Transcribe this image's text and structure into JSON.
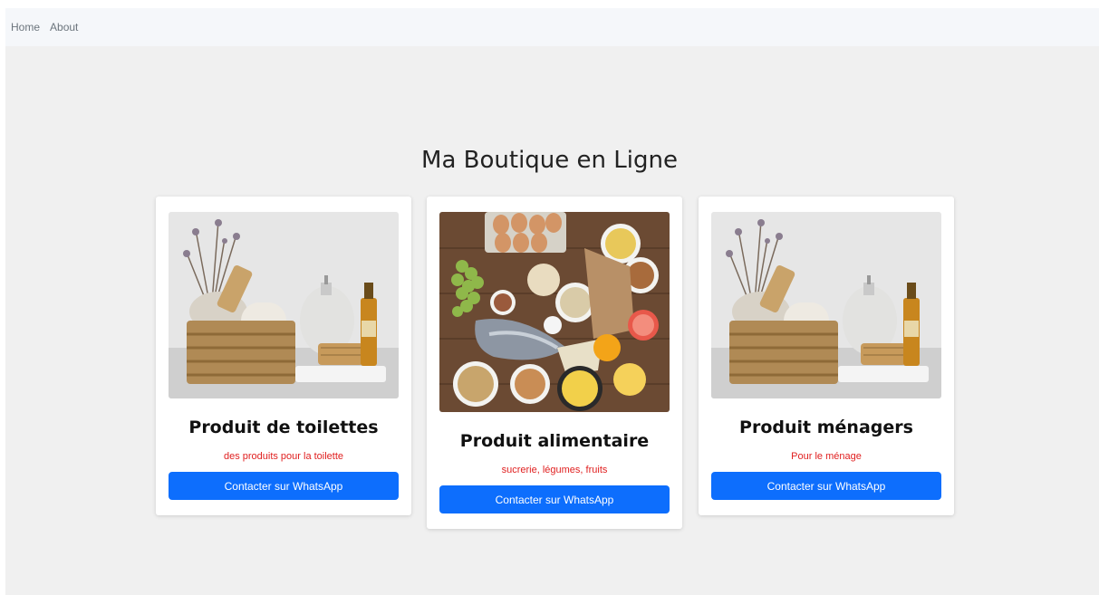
{
  "nav": {
    "items": [
      {
        "label": "Home"
      },
      {
        "label": "About"
      }
    ]
  },
  "page": {
    "title": "Ma Boutique en Ligne"
  },
  "products": [
    {
      "title": "Produit de toilettes",
      "description": "des produits pour la toilette",
      "button_label": "Contacter sur WhatsApp",
      "image_icon": "toiletries-basket-image"
    },
    {
      "title": "Produit alimentaire",
      "description": "sucrerie, légumes, fruits",
      "button_label": "Contacter sur WhatsApp",
      "image_icon": "groceries-image"
    },
    {
      "title": "Produit ménagers",
      "description": "Pour le ménage",
      "button_label": "Contacter sur WhatsApp",
      "image_icon": "toiletries-basket-image"
    }
  ],
  "colors": {
    "accent": "#0d6efd",
    "description_text": "#e02020",
    "background": "#f0f0f0"
  }
}
